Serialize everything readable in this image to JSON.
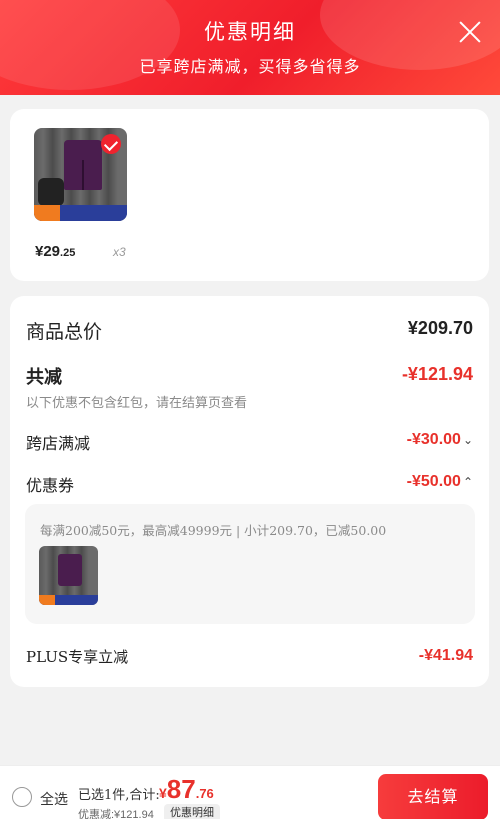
{
  "header": {
    "title": "优惠明细",
    "subtitle": "已享跨店满减，买得多省得多"
  },
  "product": {
    "price_int": "¥29",
    "price_dec": ".25",
    "quantity": "x3"
  },
  "summary": {
    "total_label": "商品总价",
    "total_value": "¥209.70",
    "reduce_label": "共减",
    "reduce_value": "-¥121.94",
    "note": "以下优惠不包含红包，请在结算页查看",
    "cross_store_label": "跨店满减",
    "cross_store_value": "-¥30.00",
    "coupon_label": "优惠券",
    "coupon_value": "-¥50.00",
    "coupon_desc": "每满200减50元，最高减49999元 | 小计209.70，已减50.00",
    "plus_label": "PLUS专享立减",
    "plus_value": "-¥41.94"
  },
  "bottom_bar": {
    "select_all": "全选",
    "selected_text": "已选1件,合计:",
    "total_currency": "¥",
    "total_int": "87",
    "total_dec": ".76",
    "discount_text": "优惠减:¥121.94",
    "detail_chip": "优惠明细",
    "checkout": "去结算"
  },
  "colors": {
    "accent": "#e8312b",
    "header_start": "#ff3b3b",
    "header_end": "#f01e2b"
  }
}
